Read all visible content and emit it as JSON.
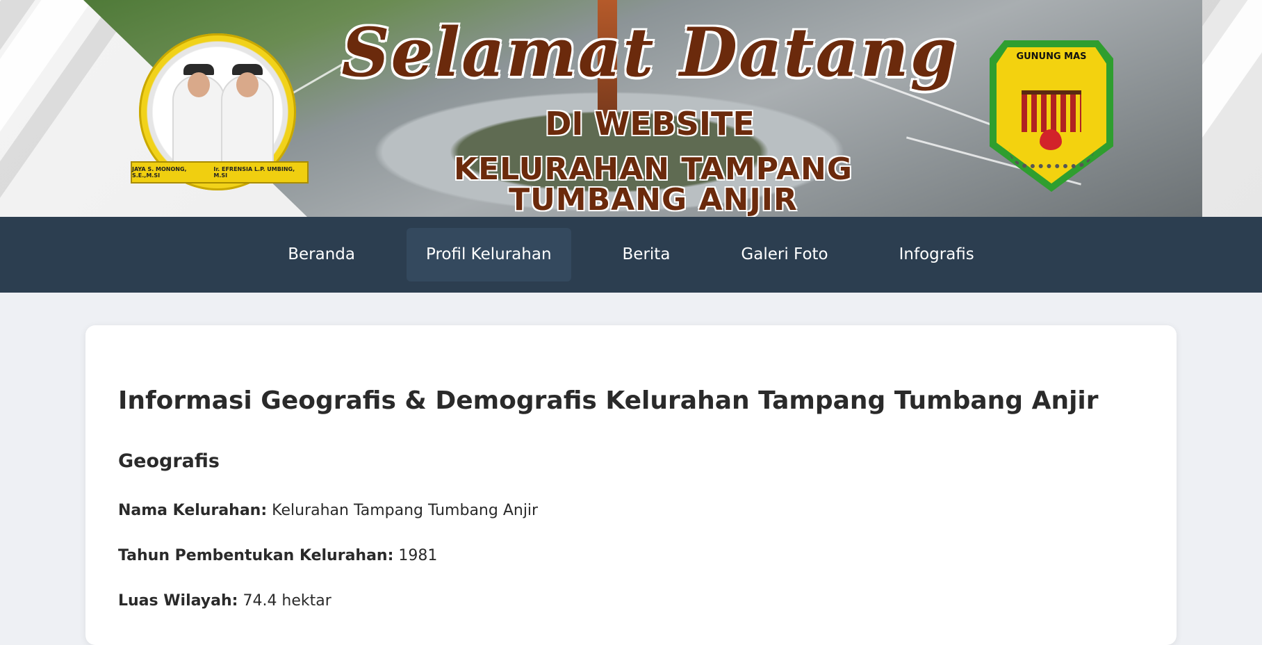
{
  "banner": {
    "title": "Selamat Datang",
    "subtitle": "DI WEBSITE",
    "subtitle2": "KELURAHAN TAMPANG TUMBANG ANJIR",
    "leaders": [
      "JAYA S. MONONG, S.E.,M.SI",
      "Ir. EFRENSIA L.P. UMBING, M.SI"
    ],
    "crest_label": "GUNUNG MAS"
  },
  "nav": {
    "items": [
      {
        "label": "Beranda"
      },
      {
        "label": "Profil Kelurahan"
      },
      {
        "label": "Berita"
      },
      {
        "label": "Galeri Foto"
      },
      {
        "label": "Infografis"
      }
    ],
    "active_index": 1
  },
  "content": {
    "title": "Informasi Geografis & Demografis Kelurahan Tampang Tumbang Anjir",
    "section_title": "Geografis",
    "rows": [
      {
        "label": "Nama Kelurahan:",
        "value": "Kelurahan Tampang Tumbang Anjir"
      },
      {
        "label": "Tahun Pembentukan Kelurahan:",
        "value": "1981"
      },
      {
        "label": "Luas Wilayah:",
        "value": "74.4 hektar"
      }
    ]
  },
  "colors": {
    "nav_bg": "#2c3e50",
    "nav_active": "#34495e",
    "page_bg": "#eef0f4",
    "title_brown": "#6b2a0c"
  }
}
